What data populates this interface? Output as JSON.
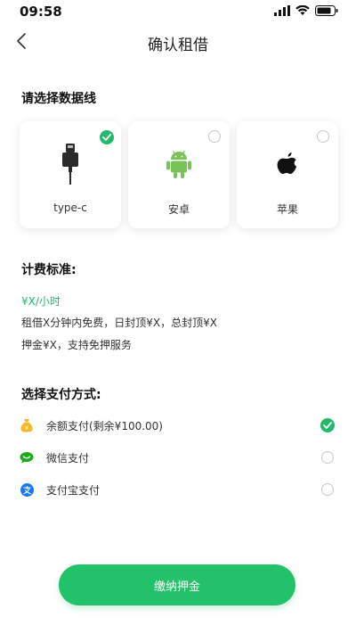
{
  "status_bar": {
    "time": "09:58"
  },
  "nav": {
    "title": "确认租借",
    "back_icon": "chevron-left-icon"
  },
  "cable_section": {
    "title": "请选择数据线",
    "options": [
      {
        "label": "type-c",
        "icon": "usb-c-plug-icon",
        "selected": true
      },
      {
        "label": "安卓",
        "icon": "android-icon",
        "selected": false
      },
      {
        "label": "苹果",
        "icon": "apple-icon",
        "selected": false
      }
    ]
  },
  "fee_section": {
    "title": "计费标准:",
    "price": "¥X/小时",
    "rule_line1": "租借X分钟内免费，日封顶¥X，总封顶¥X",
    "rule_line2": "押金¥X，支持免押服务"
  },
  "payment_section": {
    "title": "选择支付方式:",
    "methods": [
      {
        "label": "余额支付(剩余¥100.00)",
        "icon": "money-bag-icon",
        "selected": true
      },
      {
        "label": "微信支付",
        "icon": "wechat-icon",
        "selected": false
      },
      {
        "label": "支付宝支付",
        "icon": "alipay-icon",
        "selected": false
      }
    ]
  },
  "submit": {
    "label": "缴纳押金"
  },
  "colors": {
    "accent": "#22c16a",
    "price_text": "#22b96b",
    "balance_icon": "#f5b928",
    "wechat_icon": "#1aad19",
    "alipay_icon": "#1677ff",
    "android_icon": "#78c257"
  }
}
